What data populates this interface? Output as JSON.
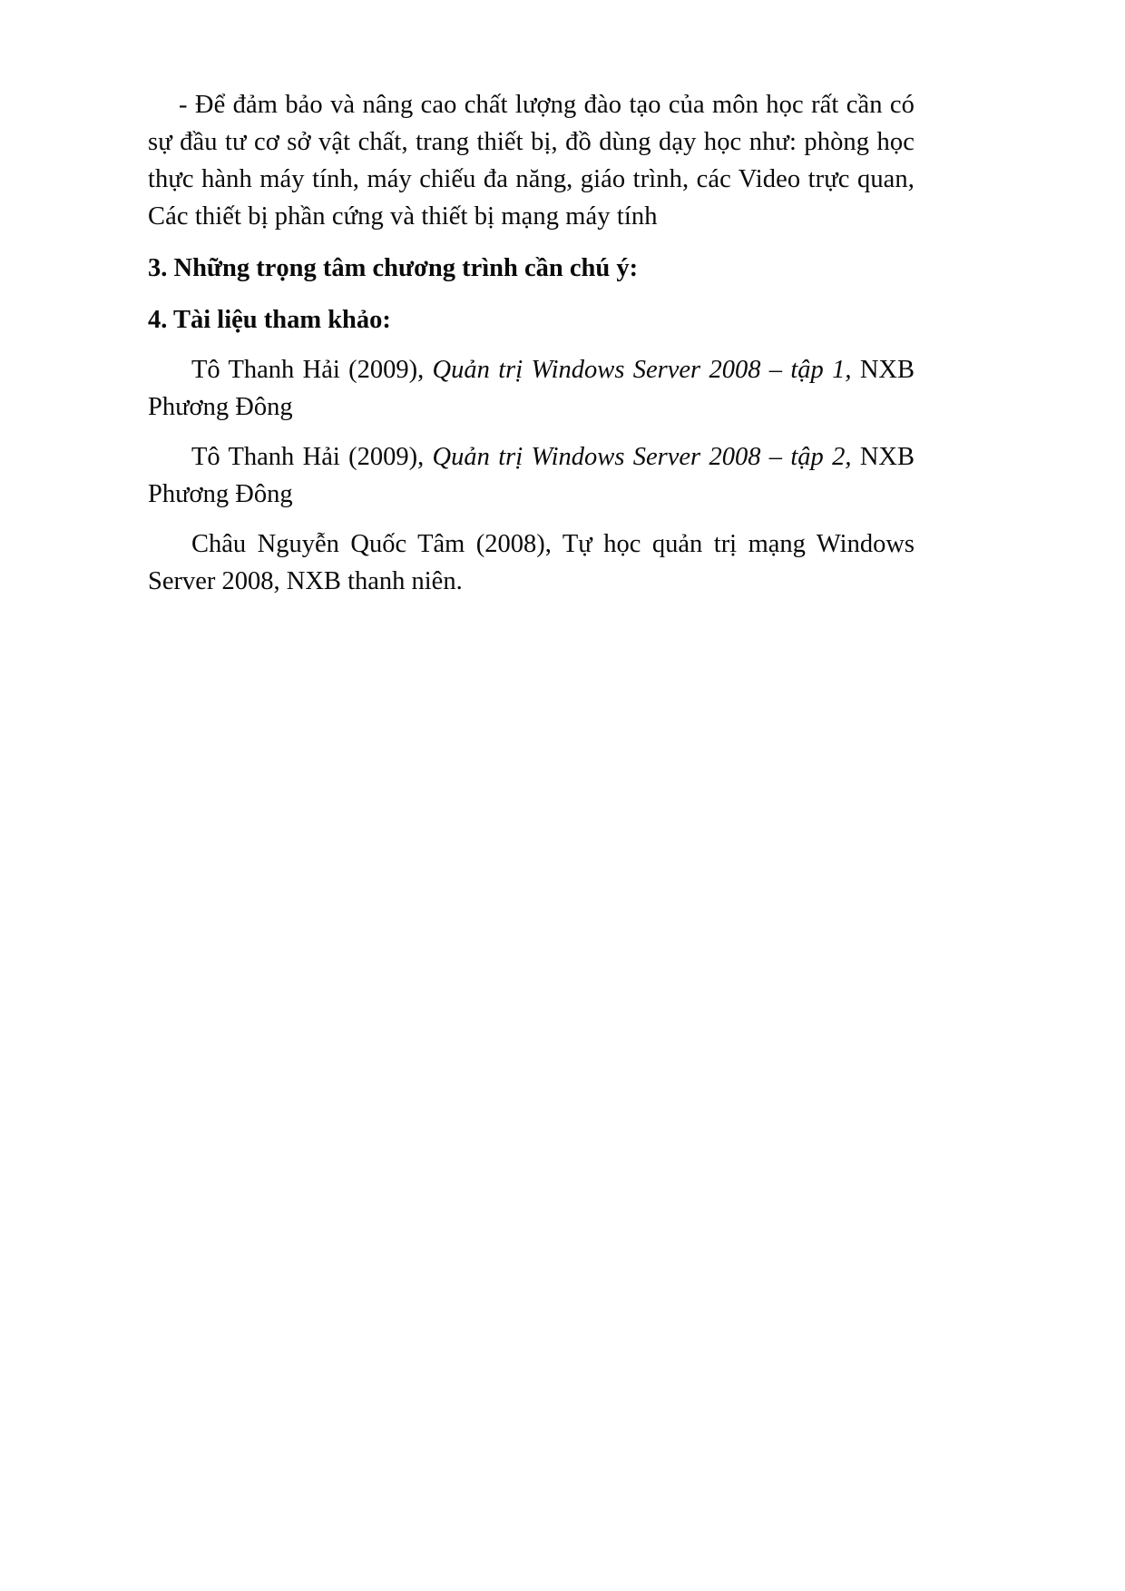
{
  "document": {
    "paragraphs": [
      {
        "id": "facilities-paragraph",
        "text": "- Để đảm bảo và nâng cao chất lượng đào tạo của môn học rất cần có sự đầu tư cơ sở vật chất, trang thiết bị, đồ dùng dạy học như: phòng học thực hành máy tính, máy chiếu đa năng, giáo trình, các Video trực quan, Các thiết bị phần cứng và thiết bị mạng máy tính"
      }
    ],
    "headings": {
      "section_3": "3. Những trọng tâm chương trình cần chú ý:",
      "section_4": "4. Tài liệu tham khảo:"
    },
    "references": [
      {
        "id": "reference-1",
        "author_year": "Tô Thanh Hải (2009), ",
        "title": "Quản trị Windows Server 2008 – tập 1,",
        "publisher": " NXB Phương Đông",
        "title_italic": true
      },
      {
        "id": "reference-2",
        "author_year": "Tô Thanh Hải (2009), ",
        "title": "Quản trị Windows Server 2008 – tập 2,",
        "publisher": " NXB Phương Đông",
        "title_italic": true
      },
      {
        "id": "reference-3",
        "author_year": "Châu Nguyễn Quốc Tâm (2008), ",
        "title": "Tự học quản trị mạng Windows Server 2008,",
        "publisher": " NXB thanh niên.",
        "title_italic": false
      }
    ]
  }
}
